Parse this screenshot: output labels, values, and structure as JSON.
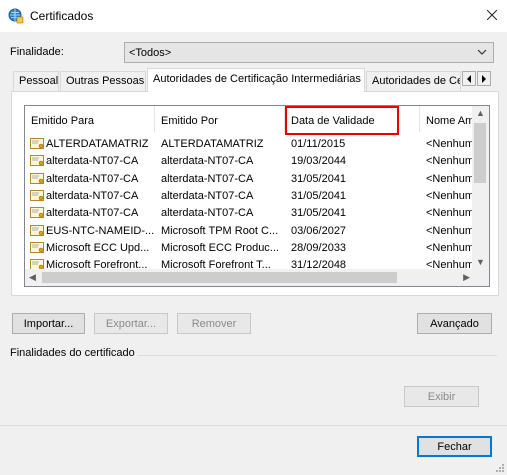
{
  "window": {
    "title": "Certificados",
    "title_icon": "certificate-globe-icon"
  },
  "purpose": {
    "label": "Finalidade:",
    "selected": "<Todos>"
  },
  "tabs": [
    {
      "label": "Pessoal",
      "active": false
    },
    {
      "label": "Outras Pessoas",
      "active": false
    },
    {
      "label": "Autoridades de Certificação Intermediárias",
      "active": true
    },
    {
      "label": "Autoridades de Certificação Raiz Confiáveis",
      "active": false
    }
  ],
  "list": {
    "columns": [
      "Emitido Para",
      "Emitido Por",
      "Data de Validade",
      "Nome Amigável"
    ],
    "highlighted_column": "Data de Validade",
    "rows": [
      {
        "issued_to": "ALTERDATAMATRIZ",
        "issued_by": "ALTERDATAMATRIZ",
        "expires": "01/11/2015",
        "friendly": "<Nenhum>"
      },
      {
        "issued_to": "alterdata-NT07-CA",
        "issued_by": "alterdata-NT07-CA",
        "expires": "19/03/2044",
        "friendly": "<Nenhum>"
      },
      {
        "issued_to": "alterdata-NT07-CA",
        "issued_by": "alterdata-NT07-CA",
        "expires": "31/05/2041",
        "friendly": "<Nenhum>"
      },
      {
        "issued_to": "alterdata-NT07-CA",
        "issued_by": "alterdata-NT07-CA",
        "expires": "31/05/2041",
        "friendly": "<Nenhum>"
      },
      {
        "issued_to": "alterdata-NT07-CA",
        "issued_by": "alterdata-NT07-CA",
        "expires": "31/05/2041",
        "friendly": "<Nenhum>"
      },
      {
        "issued_to": "EUS-NTC-NAMEID-...",
        "issued_by": "Microsoft TPM Root C...",
        "expires": "03/06/2027",
        "friendly": "<Nenhum>"
      },
      {
        "issued_to": "Microsoft ECC Upd...",
        "issued_by": "Microsoft ECC Produc...",
        "expires": "28/09/2033",
        "friendly": "<Nenhum>"
      },
      {
        "issued_to": "Microsoft Forefront...",
        "issued_by": "Microsoft Forefront T...",
        "expires": "31/12/2048",
        "friendly": "<Nenhum>"
      }
    ]
  },
  "buttons": {
    "import": "Importar...",
    "export": "Exportar...",
    "remove": "Remover",
    "advanced": "Avançado",
    "view": "Exibir",
    "close": "Fechar"
  },
  "group": {
    "title": "Finalidades do certificado"
  },
  "colors": {
    "highlight": "#e00000",
    "default_button_border": "#0078d7"
  }
}
